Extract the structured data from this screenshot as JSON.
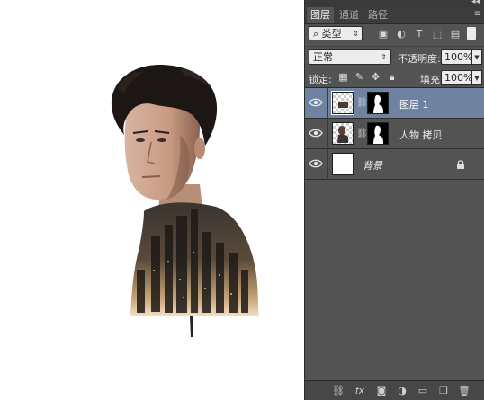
{
  "panel": {
    "tabs": [
      "图层",
      "通道",
      "路径"
    ],
    "filter_kind": "类型",
    "blend_mode": "正常",
    "opacity_label": "不透明度:",
    "opacity_value": "100%",
    "lock_label": "锁定:",
    "fill_label": "填充:",
    "fill_value": "100%"
  },
  "layers": [
    {
      "name": "图层 1",
      "selected": true,
      "visible": true
    },
    {
      "name": "人物 拷贝",
      "selected": false,
      "visible": true
    },
    {
      "name": "背景",
      "selected": false,
      "visible": true,
      "locked": true
    }
  ],
  "colors": {
    "panel_bg": "#535353",
    "selected_layer": "#6f829f",
    "canvas_bg": "#ffffff"
  },
  "icons": {
    "filter": [
      "search-icon",
      "image-filter-icon",
      "adjustment-filter-icon",
      "type-filter-icon",
      "shape-filter-icon",
      "smart-object-filter-icon"
    ],
    "lock": [
      "lock-transparent-icon",
      "lock-paint-icon",
      "lock-move-icon",
      "lock-all-icon"
    ],
    "bottom": [
      "link-layers-icon",
      "fx-icon",
      "add-mask-icon",
      "adjustment-layer-icon",
      "new-group-icon",
      "new-layer-icon",
      "delete-icon"
    ]
  }
}
